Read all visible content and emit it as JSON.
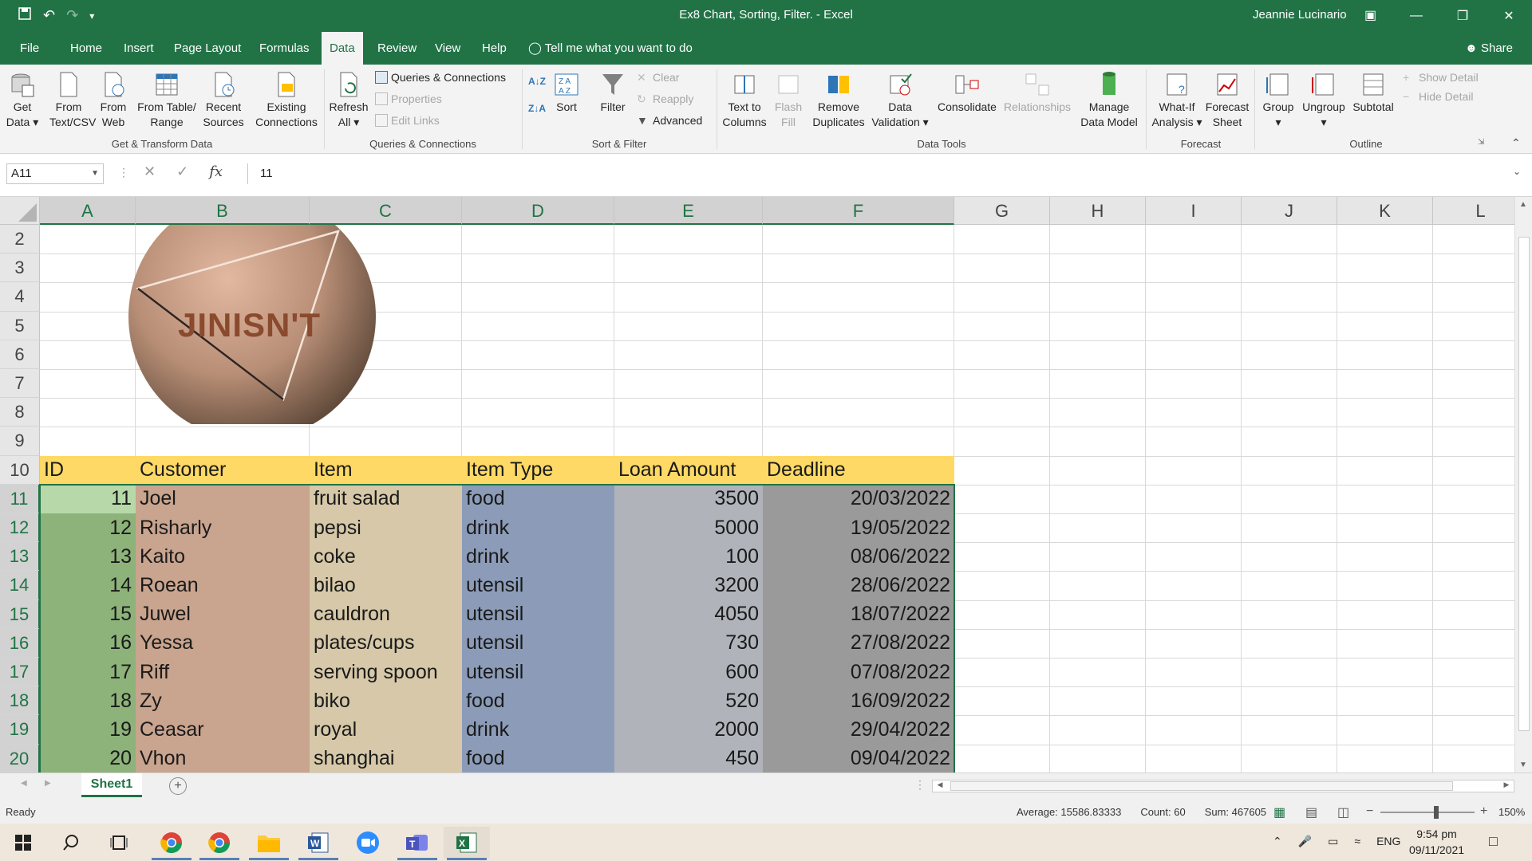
{
  "window": {
    "title": "Ex8 Chart, Sorting, Filter.  -  Excel",
    "user": "Jeannie Lucinario"
  },
  "menu": {
    "tabs": [
      "File",
      "Home",
      "Insert",
      "Page Layout",
      "Formulas",
      "Data",
      "Review",
      "View",
      "Help"
    ],
    "active_tab": "Data",
    "tell_me": "Tell me what you want to do",
    "share": "Share"
  },
  "ribbon": {
    "get_transform": {
      "label": "Get & Transform Data",
      "get_data": [
        "Get",
        "Data"
      ],
      "from_text": [
        "From",
        "Text/CSV"
      ],
      "from_web": [
        "From",
        "Web"
      ],
      "from_table": [
        "From Table/",
        "Range"
      ],
      "recent_sources": [
        "Recent",
        "Sources"
      ],
      "existing_connections": [
        "Existing",
        "Connections"
      ]
    },
    "queries": {
      "label": "Queries & Connections",
      "refresh_all": [
        "Refresh",
        "All"
      ],
      "queries_connections": "Queries & Connections",
      "properties": "Properties",
      "edit_links": "Edit Links"
    },
    "sort_filter": {
      "label": "Sort & Filter",
      "sort": "Sort",
      "filter": "Filter",
      "clear": "Clear",
      "reapply": "Reapply",
      "advanced": "Advanced"
    },
    "data_tools": {
      "label": "Data Tools",
      "text_to_columns": [
        "Text to",
        "Columns"
      ],
      "flash_fill": [
        "Flash",
        "Fill"
      ],
      "remove_duplicates": [
        "Remove",
        "Duplicates"
      ],
      "data_validation": [
        "Data",
        "Validation"
      ],
      "consolidate": "Consolidate",
      "relationships": "Relationships",
      "manage_data_model": [
        "Manage",
        "Data Model"
      ]
    },
    "forecast": {
      "label": "Forecast",
      "what_if": [
        "What-If",
        "Analysis"
      ],
      "forecast_sheet": [
        "Forecast",
        "Sheet"
      ]
    },
    "outline": {
      "label": "Outline",
      "group": "Group",
      "ungroup": "Ungroup",
      "subtotal": "Subtotal",
      "show_detail": "Show Detail",
      "hide_detail": "Hide Detail"
    }
  },
  "formula_bar": {
    "name_box": "A11",
    "formula": "11"
  },
  "sheet": {
    "columns": [
      "A",
      "B",
      "C",
      "D",
      "E",
      "F",
      "G",
      "H",
      "I",
      "J",
      "K",
      "L"
    ],
    "rows": [
      "2",
      "3",
      "4",
      "5",
      "6",
      "7",
      "8",
      "9",
      "10",
      "11",
      "12",
      "13",
      "14",
      "15",
      "16",
      "17",
      "18",
      "19",
      "20"
    ],
    "logo_text": "JINISN'T",
    "headers": [
      "ID",
      "Customer",
      "Item",
      "Item Type",
      "Loan Amount",
      "Deadline"
    ],
    "data": [
      [
        "11",
        "Joel",
        "fruit salad",
        "food",
        "3500",
        "20/03/2022"
      ],
      [
        "12",
        "Risharly",
        "pepsi",
        "drink",
        "5000",
        "19/05/2022"
      ],
      [
        "13",
        "Kaito",
        "coke",
        "drink",
        "100",
        "08/06/2022"
      ],
      [
        "14",
        "Roean",
        "bilao",
        "utensil",
        "3200",
        "28/06/2022"
      ],
      [
        "15",
        "Juwel",
        "cauldron",
        "utensil",
        "4050",
        "18/07/2022"
      ],
      [
        "16",
        "Yessa",
        "plates/cups",
        "utensil",
        "730",
        "27/08/2022"
      ],
      [
        "17",
        "Riff",
        "serving spoon",
        "utensil",
        "600",
        "07/08/2022"
      ],
      [
        "18",
        "Zy",
        "biko",
        "food",
        "520",
        "16/09/2022"
      ],
      [
        "19",
        "Ceasar",
        "royal",
        "drink",
        "2000",
        "29/04/2022"
      ],
      [
        "20",
        "Vhon",
        "shanghai",
        "food",
        "450",
        "09/04/2022"
      ]
    ],
    "colors": {
      "header_row": "#ffd966",
      "col_a": "#8db27a",
      "col_a_active": "#b7d8a8",
      "col_b": "#c9a48e",
      "col_c": "#d6c8a8",
      "col_d": "#8c9cb8",
      "col_e": "#b0b4ba",
      "col_f": "#9a9a9a"
    }
  },
  "sheet_tabs": {
    "active": "Sheet1"
  },
  "status": {
    "ready": "Ready",
    "average": "Average: 15586.83333",
    "count": "Count: 60",
    "sum": "Sum: 467605",
    "zoom": "150%"
  },
  "taskbar": {
    "lang": "ENG",
    "time": "9:54 pm",
    "date": "09/11/2021"
  }
}
